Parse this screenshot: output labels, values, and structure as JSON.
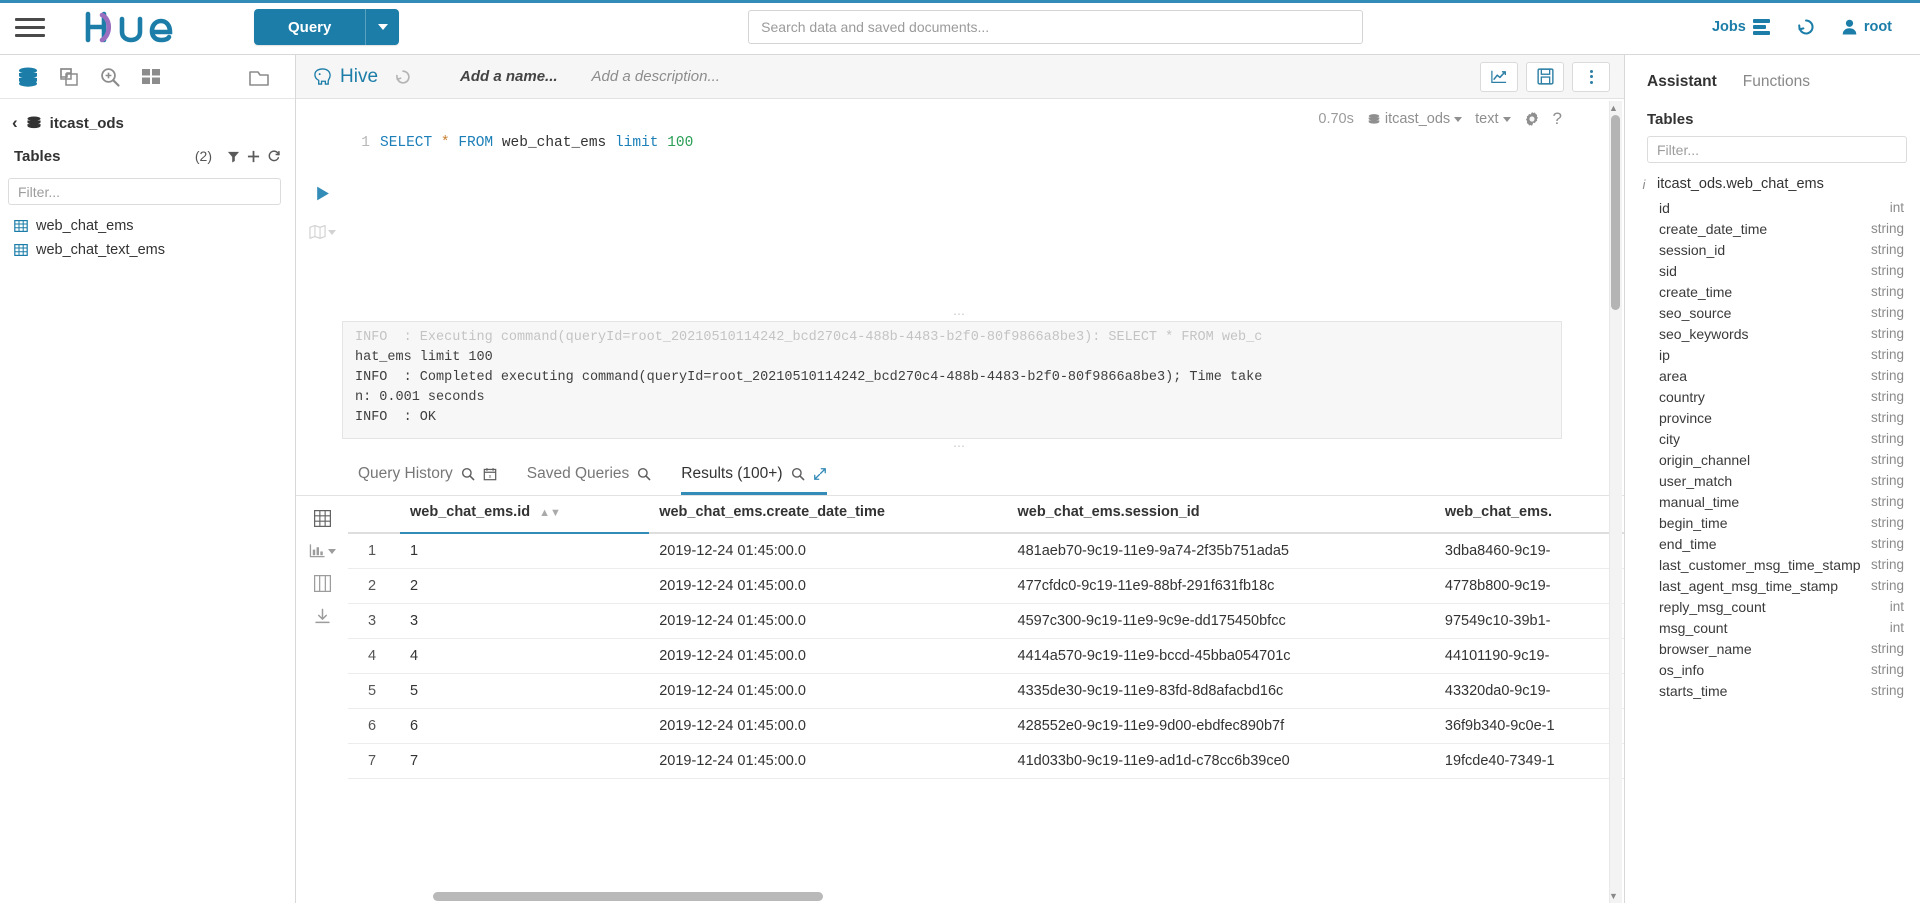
{
  "topbar": {
    "hamburger": "menu-icon",
    "logo_text": "hue",
    "query_button": "Query",
    "search_placeholder": "Search data and saved documents...",
    "search_value": "",
    "jobs_label": "Jobs",
    "history_icon": "history-icon",
    "user_label": "root",
    "accent": "#1b7da8"
  },
  "left_panel": {
    "icons": [
      "database-icon",
      "copy-icon",
      "search-plus-icon",
      "grid-icon",
      "briefcase-icon"
    ],
    "breadcrumb_back": "‹",
    "database": "itcast_ods",
    "tables_title": "Tables",
    "tables_count": "(2)",
    "filter_placeholder": "Filter...",
    "filter_value": "",
    "tables": [
      {
        "name": "web_chat_ems"
      },
      {
        "name": "web_chat_text_ems"
      }
    ]
  },
  "editor": {
    "engine": "Hive",
    "history_icon": "history-icon",
    "name_placeholder": "Add a name...",
    "description_placeholder": "Add a description...",
    "toolbar_buttons": [
      "chart-icon",
      "save-icon",
      "more-vertical-icon"
    ],
    "exec_time": "0.70s",
    "database": "itcast_ods",
    "result_format": "text",
    "settings_icon": "gear-icon",
    "help_icon": "help-icon",
    "line_number": "1",
    "sql": {
      "keyword1": "SELECT",
      "star": "*",
      "keyword2": "FROM",
      "table": "web_chat_ems",
      "keyword3": "limit",
      "number": "100"
    },
    "log_lines": [
      "INFO  : Executing command(queryId=root_20210510114242_bcd270c4-488b-4483-b2f0-80f9866a8be3): SELECT * FROM web_c",
      "hat_ems limit 100",
      "INFO  : Completed executing command(queryId=root_20210510114242_bcd270c4-488b-4483-b2f0-80f9866a8be3); Time take",
      "n: 0.001 seconds",
      "INFO  : OK"
    ]
  },
  "result_tabs": [
    {
      "label": "Query History",
      "icons": [
        "search-icon",
        "calendar-icon"
      ],
      "active": false
    },
    {
      "label": "Saved Queries",
      "icons": [
        "search-icon"
      ],
      "active": false
    },
    {
      "label": "Results (100+)",
      "icons": [
        "search-icon",
        "expand-icon"
      ],
      "active": true
    }
  ],
  "results": {
    "side_icons": [
      "grid-view-icon",
      "chart-view-icon",
      "columns-view-icon",
      "download-icon"
    ],
    "columns": [
      "web_chat_ems.id",
      "web_chat_ems.create_date_time",
      "web_chat_ems.session_id",
      "web_chat_ems."
    ],
    "rows": [
      [
        "1",
        "1",
        "2019-12-24 01:45:00.0",
        "481aeb70-9c19-11e9-9a74-2f35b751ada5",
        "3dba8460-9c19-"
      ],
      [
        "2",
        "2",
        "2019-12-24 01:45:00.0",
        "477cfdc0-9c19-11e9-88bf-291f631fb18c",
        "4778b800-9c19-"
      ],
      [
        "3",
        "3",
        "2019-12-24 01:45:00.0",
        "4597c300-9c19-11e9-9c9e-dd175450bfcc",
        "97549c10-39b1-"
      ],
      [
        "4",
        "4",
        "2019-12-24 01:45:00.0",
        "4414a570-9c19-11e9-bccd-45bba054701c",
        "44101190-9c19-"
      ],
      [
        "5",
        "5",
        "2019-12-24 01:45:00.0",
        "4335de30-9c19-11e9-83fd-8d8afacbd16c",
        "43320da0-9c19-"
      ],
      [
        "6",
        "6",
        "2019-12-24 01:45:00.0",
        "428552e0-9c19-11e9-9d00-ebdfec890b7f",
        "36f9b340-9c0e-1"
      ],
      [
        "7",
        "7",
        "2019-12-24 01:45:00.0",
        "41d033b0-9c19-11e9-ad1d-c78cc6b39ce0",
        "19fcde40-7349-1"
      ]
    ]
  },
  "assistant": {
    "tabs": [
      {
        "label": "Assistant",
        "active": true
      },
      {
        "label": "Functions",
        "active": false
      }
    ],
    "section_title": "Tables",
    "filter_placeholder": "Filter...",
    "filter_value": "",
    "table_name": "itcast_ods.web_chat_ems",
    "columns": [
      {
        "name": "id",
        "type": "int"
      },
      {
        "name": "create_date_time",
        "type": "string"
      },
      {
        "name": "session_id",
        "type": "string"
      },
      {
        "name": "sid",
        "type": "string"
      },
      {
        "name": "create_time",
        "type": "string"
      },
      {
        "name": "seo_source",
        "type": "string"
      },
      {
        "name": "seo_keywords",
        "type": "string"
      },
      {
        "name": "ip",
        "type": "string"
      },
      {
        "name": "area",
        "type": "string"
      },
      {
        "name": "country",
        "type": "string"
      },
      {
        "name": "province",
        "type": "string"
      },
      {
        "name": "city",
        "type": "string"
      },
      {
        "name": "origin_channel",
        "type": "string"
      },
      {
        "name": "user_match",
        "type": "string"
      },
      {
        "name": "manual_time",
        "type": "string"
      },
      {
        "name": "begin_time",
        "type": "string"
      },
      {
        "name": "end_time",
        "type": "string"
      },
      {
        "name": "last_customer_msg_time_stamp",
        "type": "string"
      },
      {
        "name": "last_agent_msg_time_stamp",
        "type": "string"
      },
      {
        "name": "reply_msg_count",
        "type": "int"
      },
      {
        "name": "msg_count",
        "type": "int"
      },
      {
        "name": "browser_name",
        "type": "string"
      },
      {
        "name": "os_info",
        "type": "string"
      },
      {
        "name": "starts_time",
        "type": "string"
      }
    ]
  }
}
